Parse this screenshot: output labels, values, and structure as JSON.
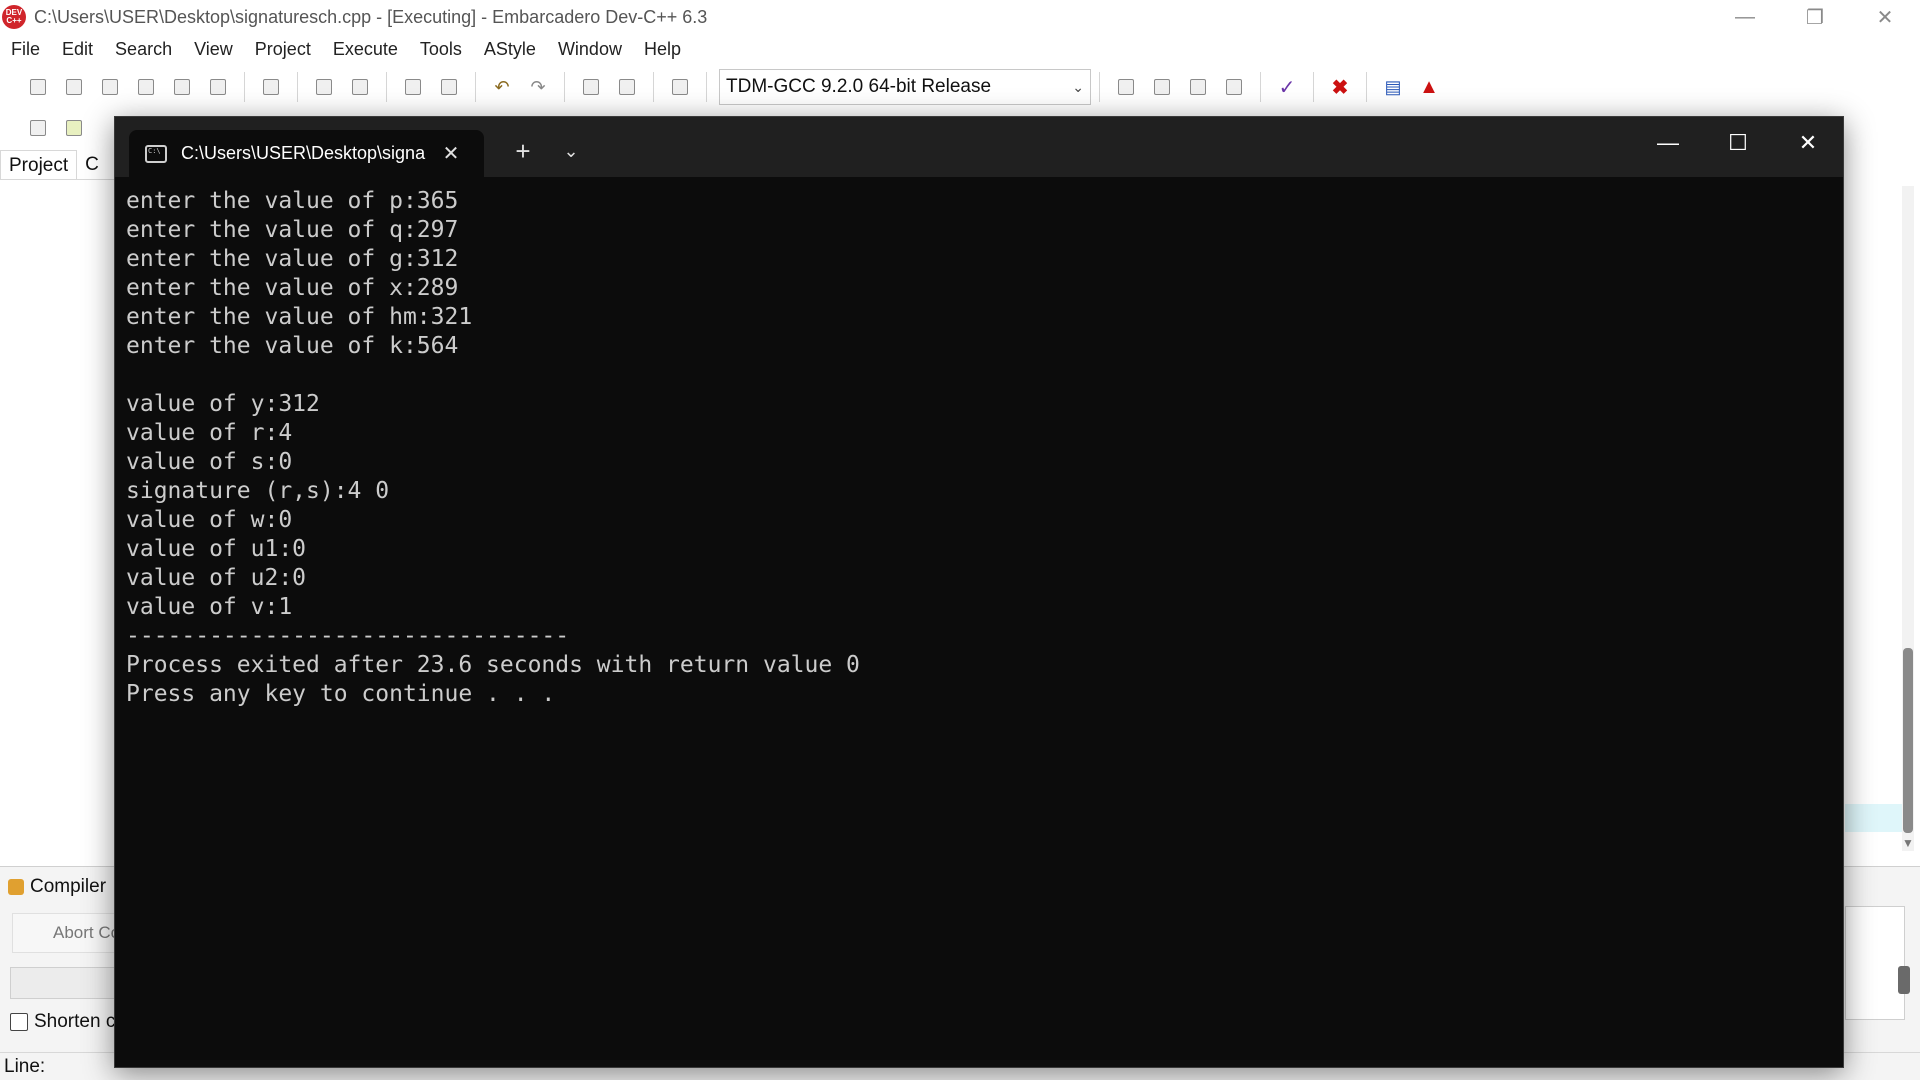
{
  "ide": {
    "title": "C:\\Users\\USER\\Desktop\\signaturesch.cpp - [Executing] - Embarcadero Dev-C++ 6.3",
    "app_icon_text": "DEV C++",
    "menu": [
      "File",
      "Edit",
      "Search",
      "View",
      "Project",
      "Execute",
      "Tools",
      "AStyle",
      "Window",
      "Help"
    ],
    "compiler_select": "TDM-GCC 9.2.0 64-bit Release",
    "panel_tabs": [
      "Project",
      "C"
    ],
    "bottom_panel_title": "Compiler",
    "abort_label": "Abort Co",
    "shorten_label": "Shorten c",
    "status_line_label": "Line:"
  },
  "terminal": {
    "tab_title": "C:\\Users\\USER\\Desktop\\signa",
    "lines": [
      "enter the value of p:365",
      "enter the value of q:297",
      "enter the value of g:312",
      "enter the value of x:289",
      "enter the value of hm:321",
      "enter the value of k:564",
      "",
      "value of y:312",
      "value of r:4",
      "value of s:0",
      "signature (r,s):4 0",
      "value of w:0",
      "value of u1:0",
      "value of u2:0",
      "value of v:1",
      "--------------------------------",
      "Process exited after 23.6 seconds with return value 0",
      "Press any key to continue . . ."
    ]
  }
}
